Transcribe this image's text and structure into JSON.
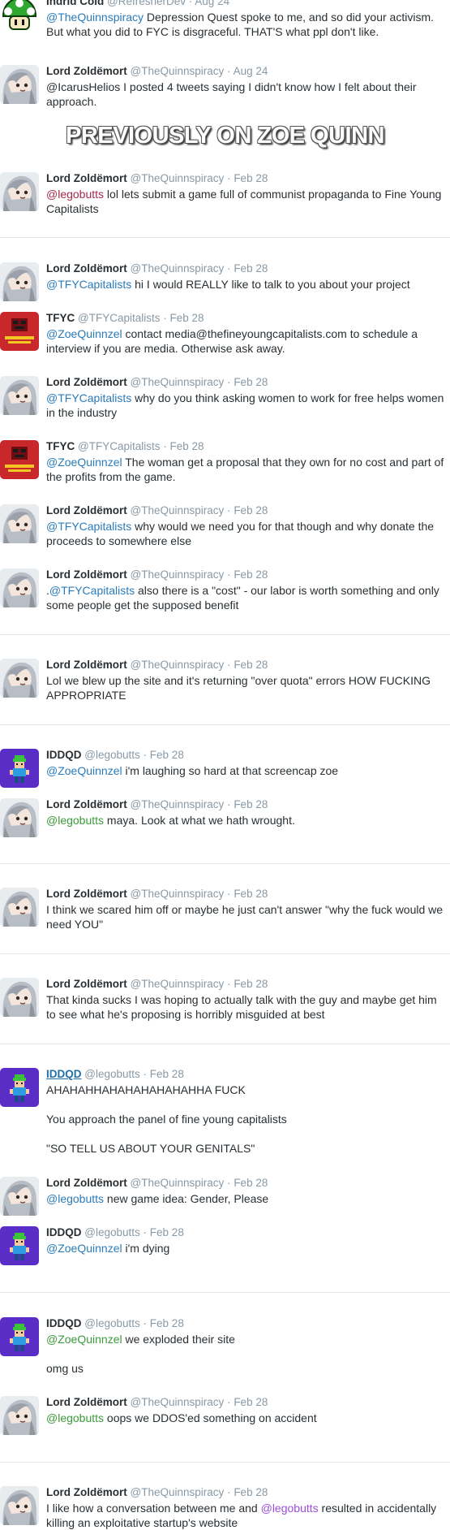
{
  "colors": {
    "mention_blue": "#2b7bb9",
    "mention_pink": "#a52a4c",
    "mention_green": "#3b9a3b",
    "mention_purple": "#9b4fd9",
    "timestamp": "#8899a6"
  },
  "heading": "PREVIOUSLY ON ZOE QUINN",
  "tweets": [
    {
      "avatar": "mushroom-icon",
      "name": "Indrid Cold",
      "handle": "@RefresherDev",
      "sep": "·",
      "date": "Aug 24",
      "mention": "@TheQuinnspiracy",
      "text": " Depression Quest spoke to me, and so did your activism. But what you did to FYC is disgraceful. THAT'S what ppl don't like."
    },
    {
      "avatar": "silver-hair-icon",
      "name": "Lord Zoldëmort",
      "handle": "@TheQuinnspiracy",
      "sep": "·",
      "date": "Aug 24",
      "mention": "",
      "text": "@IcarusHelios I posted 4 tweets saying I didn't know how I felt about their approach."
    },
    {
      "avatar": "silver-hair-icon",
      "name": "Lord Zoldëmort",
      "handle": "@TheQuinnspiracy",
      "sep": "·",
      "date": "Feb 28",
      "mention": "@legobutts",
      "text": " lol lets submit a game full of communist propaganda to Fine Young Capitalists"
    },
    {
      "avatar": "silver-hair-icon",
      "name": "Lord Zoldëmort",
      "handle": "@TheQuinnspiracy",
      "sep": "·",
      "date": "Feb 28",
      "mention": "@TFYCapitalists",
      "text": " hi I would REALLY like to talk to you about your project"
    },
    {
      "avatar": "tfyc-icon",
      "name": "TFYC",
      "handle": "@TFYCapitalists",
      "sep": "·",
      "date": "Feb 28",
      "mention": "@ZoeQuinnzel",
      "text": " contact media@thefineyoungcapitalists.com to schedule a interview if you are media. Otherwise ask away."
    },
    {
      "avatar": "silver-hair-icon",
      "name": "Lord Zoldëmort",
      "handle": "@TheQuinnspiracy",
      "sep": "·",
      "date": "Feb 28",
      "mention": "@TFYCapitalists",
      "text": " why do you think asking women to work for free helps women in the industry"
    },
    {
      "avatar": "tfyc-icon",
      "name": "TFYC",
      "handle": "@TFYCapitalists",
      "sep": "·",
      "date": "Feb 28",
      "mention": "@ZoeQuinnzel",
      "text": " The woman get a proposal that they own for no cost and part of the profits from the game."
    },
    {
      "avatar": "silver-hair-icon",
      "name": "Lord Zoldëmort",
      "handle": "@TheQuinnspiracy",
      "sep": "·",
      "date": "Feb 28",
      "mention": "@TFYCapitalists",
      "text": " why would we need you for that though and why donate the proceeds to somewhere else"
    },
    {
      "avatar": "silver-hair-icon",
      "name": "Lord Zoldëmort",
      "handle": "@TheQuinnspiracy",
      "sep": "·",
      "date": "Feb 28",
      "prefix": ".",
      "mention": "@TFYCapitalists",
      "text": " also there is a \"cost\" - our labor is worth something and only some people get the supposed benefit"
    },
    {
      "avatar": "silver-hair-icon",
      "name": "Lord Zoldëmort",
      "handle": "@TheQuinnspiracy",
      "sep": "·",
      "date": "Feb 28",
      "mention": "",
      "text": "Lol we blew up the site and it's returning \"over quota\" errors HOW FUCKING APPROPRIATE"
    },
    {
      "avatar": "pixel-character-icon",
      "name": "IDDQD",
      "handle": "@legobutts",
      "sep": "·",
      "date": "Feb 28",
      "mention": "@ZoeQuinnzel",
      "text": " i'm laughing so hard at that screencap zoe"
    },
    {
      "avatar": "silver-hair-icon",
      "name": "Lord Zoldëmort",
      "handle": "@TheQuinnspiracy",
      "sep": "·",
      "date": "Feb 28",
      "mention": "@legobutts",
      "text": " maya. Look at what we hath wrought."
    },
    {
      "avatar": "silver-hair-icon",
      "name": "Lord Zoldëmort",
      "handle": "@TheQuinnspiracy",
      "sep": "·",
      "date": "Feb 28",
      "mention": "",
      "text": "I think we scared him off or maybe he just can't answer \"why the fuck would we need YOU\""
    },
    {
      "avatar": "silver-hair-icon",
      "name": "Lord Zoldëmort",
      "handle": "@TheQuinnspiracy",
      "sep": "·",
      "date": "Feb 28",
      "mention": "",
      "text": "That kinda sucks I was hoping to actually talk with the guy and maybe get him to see what he's proposing is horribly misguided at best"
    },
    {
      "avatar": "pixel-character-icon",
      "name": "IDDQD",
      "handle": "@legobutts",
      "sep": "·",
      "date": "Feb 28",
      "mention": "",
      "text": "AHAHAHHAHAHAHAHAHAHHA FUCK",
      "line2": "You approach the panel of fine young capitalists",
      "line3": "\"SO TELL US ABOUT YOUR GENITALS\""
    },
    {
      "avatar": "silver-hair-icon",
      "name": "Lord Zoldëmort",
      "handle": "@TheQuinnspiracy",
      "sep": "·",
      "date": "Feb 28",
      "mention": "@legobutts",
      "text": " new game idea: Gender, Please"
    },
    {
      "avatar": "pixel-character-icon",
      "name": "IDDQD",
      "handle": "@legobutts",
      "sep": "·",
      "date": "Feb 28",
      "mention": "@ZoeQuinnzel",
      "text": " i'm dying"
    },
    {
      "avatar": "pixel-character-icon",
      "name": "IDDQD",
      "handle": "@legobutts",
      "sep": "·",
      "date": "Feb 28",
      "mention": "@ZoeQuinnzel",
      "text": " we exploded their site",
      "line2": "omg us"
    },
    {
      "avatar": "silver-hair-icon",
      "name": "Lord Zoldëmort",
      "handle": "@TheQuinnspiracy",
      "sep": "·",
      "date": "Feb 28",
      "mention": "@legobutts",
      "text": " oops we DDOS'ed something on accident"
    },
    {
      "avatar": "silver-hair-icon",
      "name": "Lord Zoldëmort",
      "handle": "@TheQuinnspiracy",
      "sep": "·",
      "date": "Feb 28",
      "mention": "",
      "text": "I like how a conversation between me and ",
      "mention2": "@legobutts",
      "text2": " resulted in accidentally killing an exploitative startup's website"
    }
  ]
}
